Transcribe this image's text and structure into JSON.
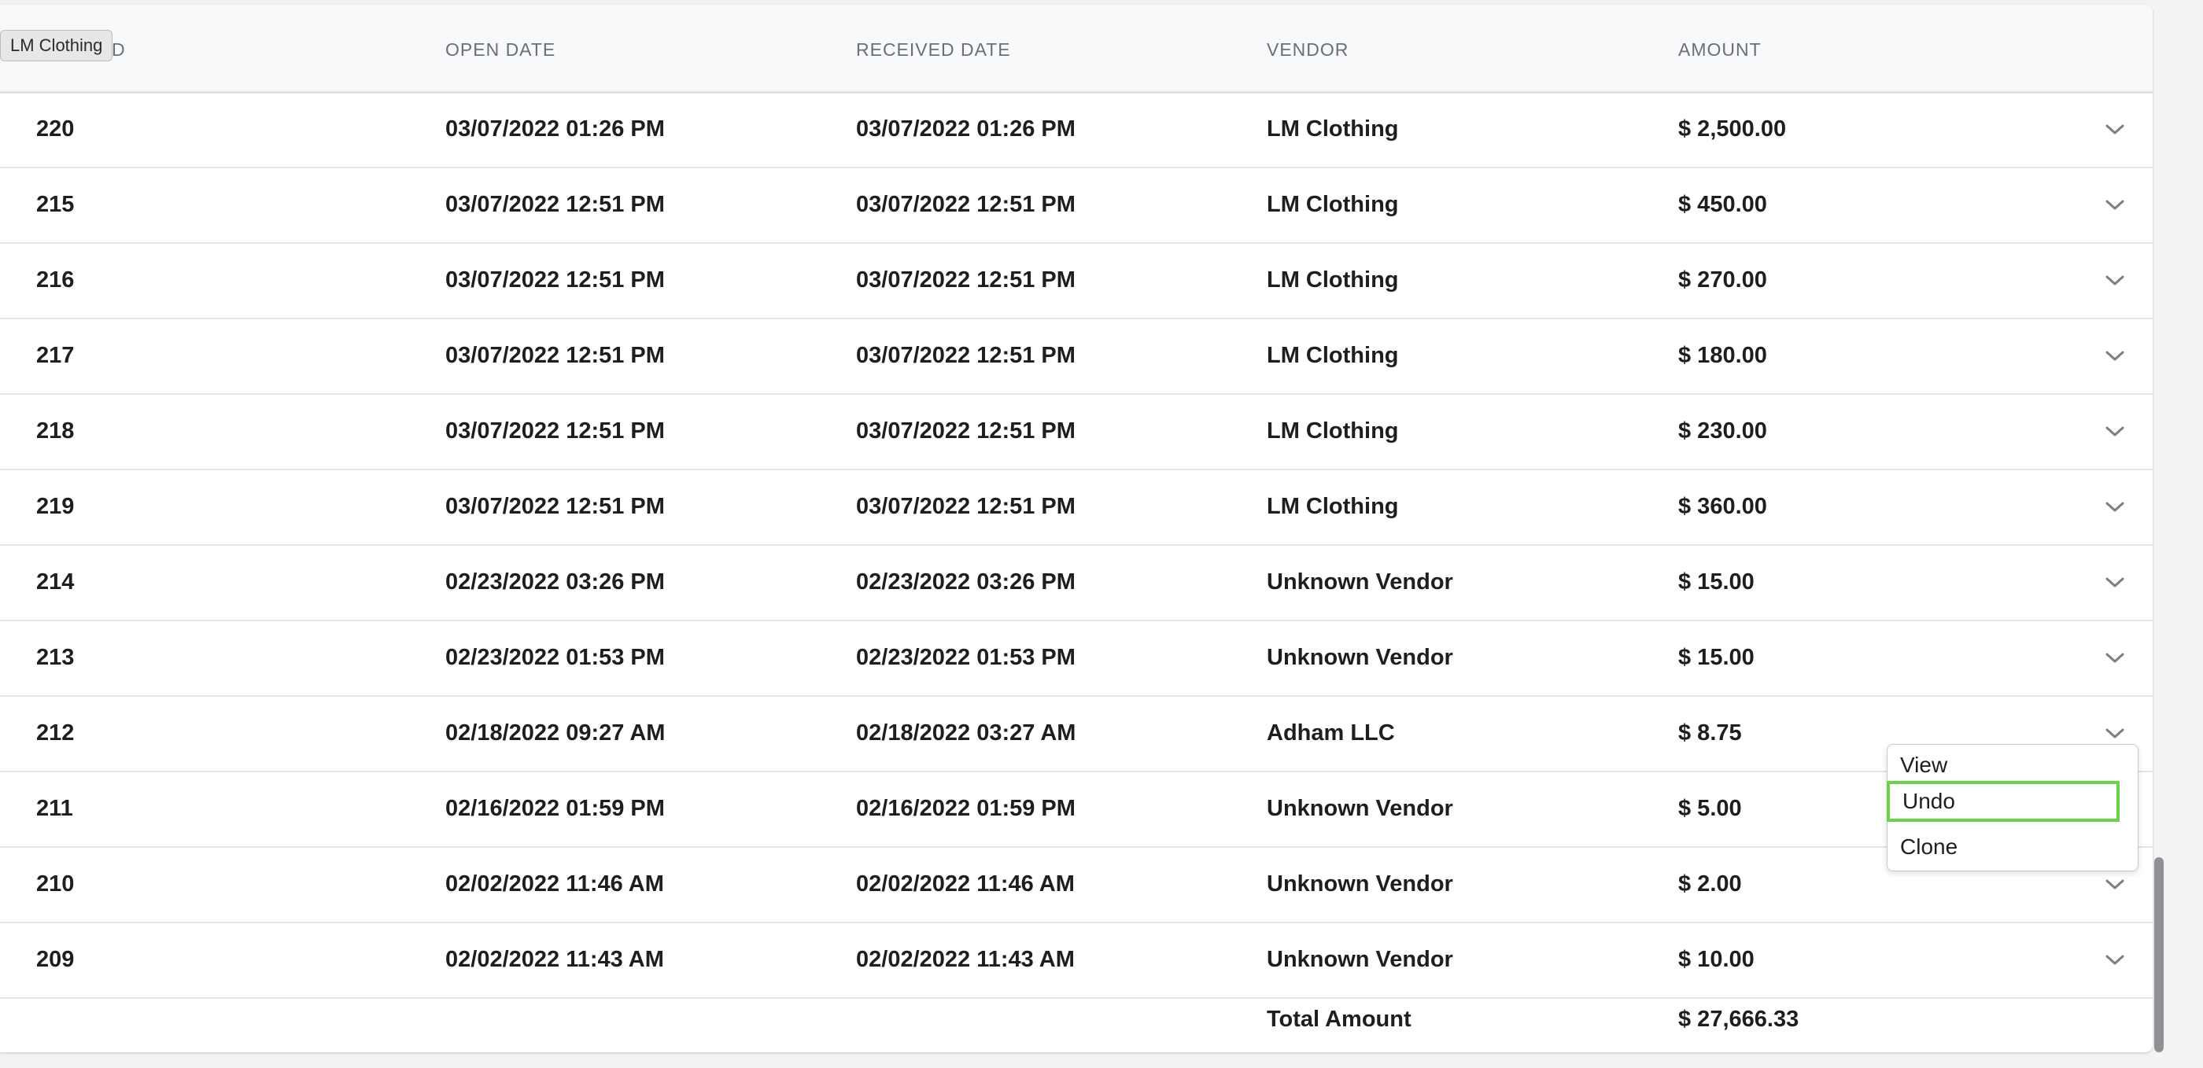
{
  "tooltip": "LM Clothing",
  "columns": {
    "id": "D",
    "open_date": "OPEN DATE",
    "received_date": "RECEIVED DATE",
    "vendor": "VENDOR",
    "amount": "AMOUNT"
  },
  "rows": [
    {
      "id": "220",
      "open": "03/07/2022 01:26 PM",
      "received": "03/07/2022 01:26 PM",
      "vendor": "LM Clothing",
      "amount": "$ 2,500.00"
    },
    {
      "id": "215",
      "open": "03/07/2022 12:51 PM",
      "received": "03/07/2022 12:51 PM",
      "vendor": "LM Clothing",
      "amount": "$ 450.00"
    },
    {
      "id": "216",
      "open": "03/07/2022 12:51 PM",
      "received": "03/07/2022 12:51 PM",
      "vendor": "LM Clothing",
      "amount": "$ 270.00"
    },
    {
      "id": "217",
      "open": "03/07/2022 12:51 PM",
      "received": "03/07/2022 12:51 PM",
      "vendor": "LM Clothing",
      "amount": "$ 180.00"
    },
    {
      "id": "218",
      "open": "03/07/2022 12:51 PM",
      "received": "03/07/2022 12:51 PM",
      "vendor": "LM Clothing",
      "amount": "$ 230.00"
    },
    {
      "id": "219",
      "open": "03/07/2022 12:51 PM",
      "received": "03/07/2022 12:51 PM",
      "vendor": "LM Clothing",
      "amount": "$ 360.00"
    },
    {
      "id": "214",
      "open": "02/23/2022 03:26 PM",
      "received": "02/23/2022 03:26 PM",
      "vendor": "Unknown Vendor",
      "amount": "$ 15.00"
    },
    {
      "id": "213",
      "open": "02/23/2022 01:53 PM",
      "received": "02/23/2022 01:53 PM",
      "vendor": "Unknown Vendor",
      "amount": "$ 15.00"
    },
    {
      "id": "212",
      "open": "02/18/2022 09:27 AM",
      "received": "02/18/2022 03:27 AM",
      "vendor": "Adham LLC",
      "amount": "$ 8.75"
    },
    {
      "id": "211",
      "open": "02/16/2022 01:59 PM",
      "received": "02/16/2022 01:59 PM",
      "vendor": "Unknown Vendor",
      "amount": "$ 5.00"
    },
    {
      "id": "210",
      "open": "02/02/2022 11:46 AM",
      "received": "02/02/2022 11:46 AM",
      "vendor": "Unknown Vendor",
      "amount": "$ 2.00"
    },
    {
      "id": "209",
      "open": "02/02/2022 11:43 AM",
      "received": "02/02/2022 11:43 AM",
      "vendor": "Unknown Vendor",
      "amount": "$ 10.00"
    }
  ],
  "total": {
    "label": "Total Amount",
    "value": "$ 27,666.33"
  },
  "menu": {
    "view": "View",
    "undo": "Undo",
    "clone": "Clone"
  },
  "icons": {
    "row_action": "chevron-down-icon"
  },
  "colors": {
    "focus_outline": "#6ad34a",
    "header_bg": "#f8f9fa"
  }
}
